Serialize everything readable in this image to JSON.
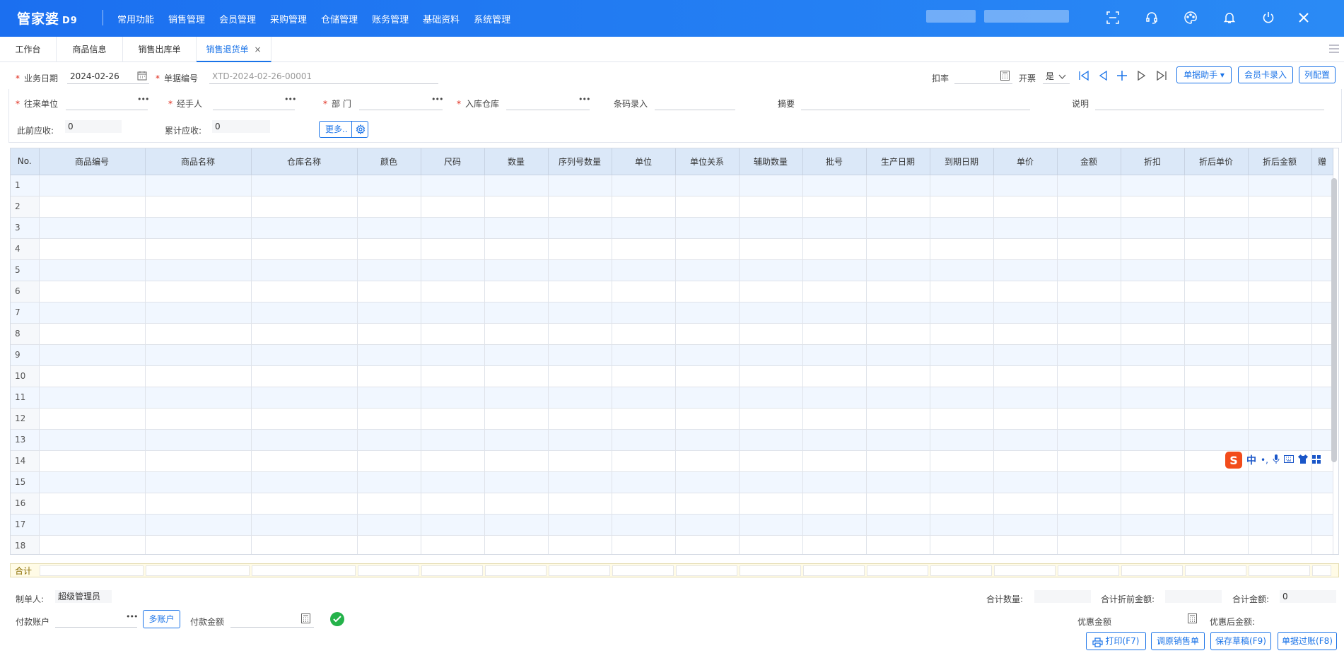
{
  "app": {
    "logo": "管家婆",
    "version": "D9"
  },
  "menu": [
    "常用功能",
    "销售管理",
    "会员管理",
    "采购管理",
    "仓储管理",
    "账务管理",
    "基础资料",
    "系统管理"
  ],
  "tabs": [
    {
      "label": "工作台"
    },
    {
      "label": "商品信息"
    },
    {
      "label": "销售出库单"
    },
    {
      "label": "销售退货单",
      "active": true,
      "close": "×"
    }
  ],
  "form": {
    "date_label": "业务日期",
    "date_value": "2024-02-26",
    "billno_label": "单据编号",
    "billno_value": "XTD-2024-02-26-00001",
    "discount_label": "扣率",
    "invoice_label": "开票",
    "invoice_value": "是",
    "assistant_btn": "单据助手 ▾",
    "member_card_btn": "会员卡录入",
    "column_btn": "列配置",
    "partner_label": "往来单位",
    "handler_label": "经手人",
    "dept_label": "部 门",
    "warehouse_label": "入库仓库",
    "barcode_label": "条码录入",
    "summary_label": "摘要",
    "note_label": "说明",
    "prev_receivable_label": "此前应收:",
    "prev_receivable_value": "0",
    "total_receivable_label": "累计应收:",
    "total_receivable_value": "0",
    "more_btn": "更多.."
  },
  "grid": {
    "columns": [
      "No.",
      "商品编号",
      "商品名称",
      "仓库名称",
      "颜色",
      "尺码",
      "数量",
      "序列号数量",
      "单位",
      "单位关系",
      "辅助数量",
      "批号",
      "生产日期",
      "到期日期",
      "单价",
      "金额",
      "折扣",
      "折后单价",
      "折后金额",
      "赠"
    ],
    "rows": [
      "1",
      "2",
      "3",
      "4",
      "5",
      "6",
      "7",
      "8",
      "9",
      "10",
      "11",
      "12",
      "13",
      "14",
      "15",
      "16",
      "17",
      "18"
    ],
    "sum_label": "合计"
  },
  "footer": {
    "maker_label": "制单人:",
    "maker_value": "超级管理员",
    "pay_account_label": "付款账户",
    "multi_account_btn": "多账户",
    "pay_amount_label": "付款金额",
    "total_qty_label": "合计数量:",
    "total_pre_discount_label": "合计折前金额:",
    "total_amount_label": "合计金额:",
    "total_amount_value": "0",
    "coupon_label": "优惠金额",
    "after_coupon_label": "优惠后金额:",
    "print_btn": "打印(F7)",
    "recall_btn": "调原销售单",
    "save_draft_btn": "保存草稿(F9)",
    "post_btn": "单据过账(F8)"
  },
  "ime": {
    "lang": "中",
    "punct": "•,"
  },
  "colors": {
    "header_blue": "#1b6ff0",
    "accent": "#1a73e8",
    "required": "#e0291a",
    "grid_header": "#dbe8f8",
    "row_alt": "#f1f7ff"
  }
}
